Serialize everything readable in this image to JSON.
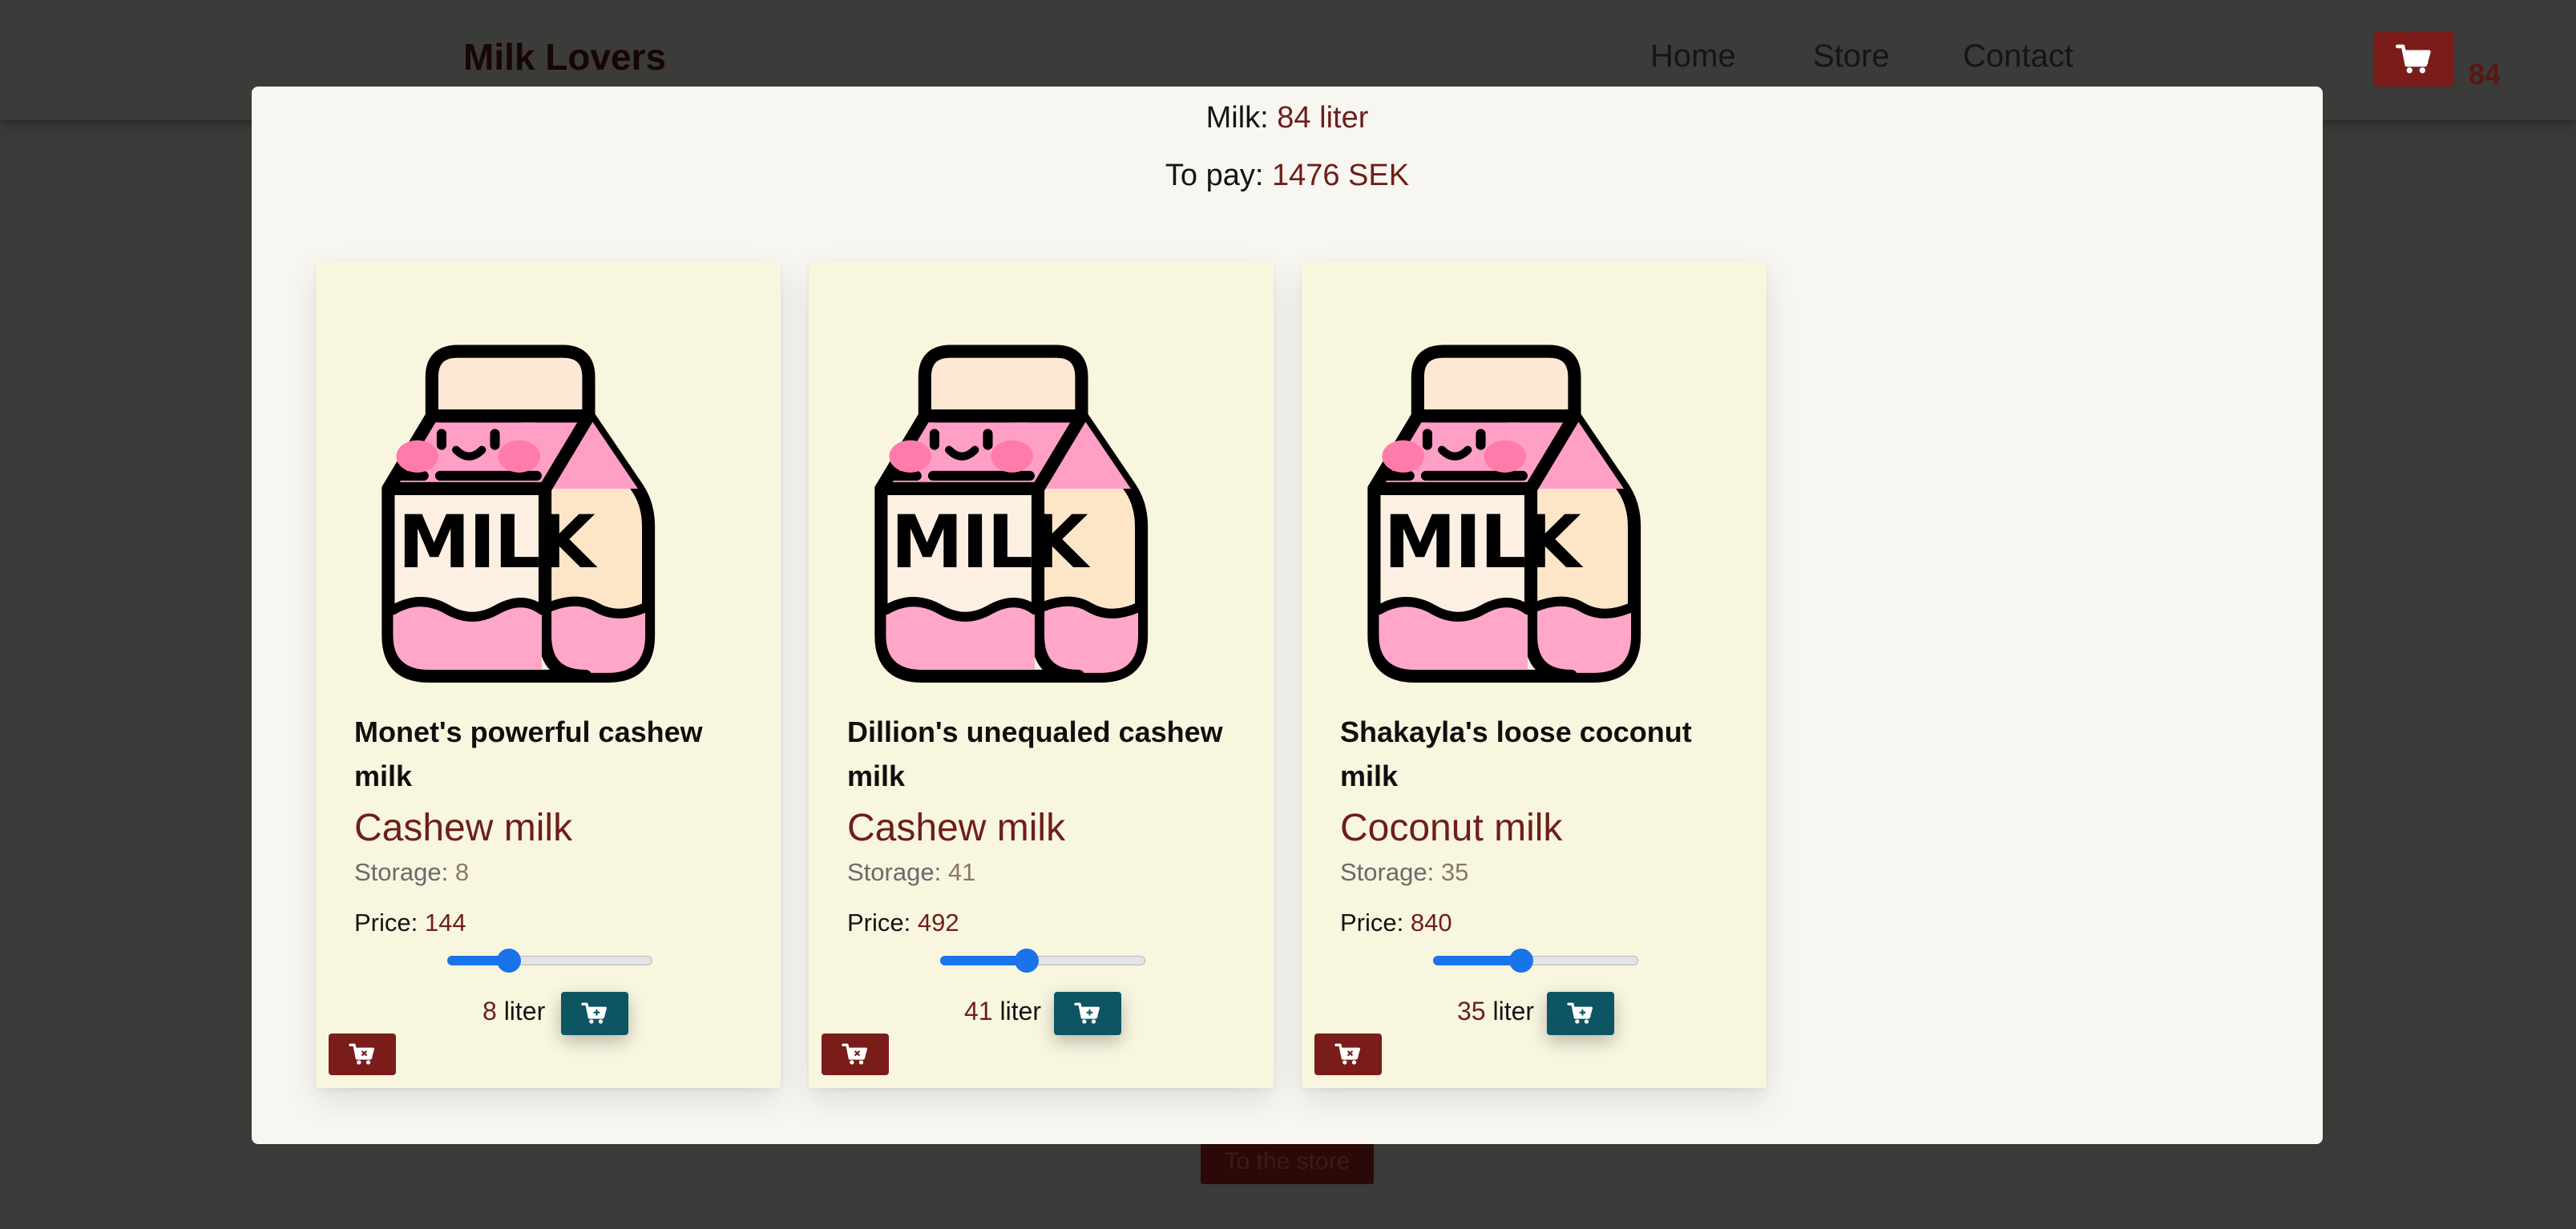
{
  "navbar": {
    "brand": "Milk Lovers",
    "links": [
      "Home",
      "Store",
      "Contact"
    ],
    "cart_count": "84"
  },
  "page": {
    "store_button": "To the store"
  },
  "modal": {
    "milk_label": "Milk:",
    "milk_value": "84 liter",
    "pay_label": "To pay:",
    "pay_value": "1476 SEK",
    "carton_text": "MILK",
    "cards": [
      {
        "name": "Monet's powerful cashew milk",
        "type": "Cashew milk",
        "storage_label": "Storage:",
        "storage": "8",
        "price_label": "Price:",
        "price": "144",
        "quantity": "8",
        "unit": "liter",
        "slider_fraction": 0.3
      },
      {
        "name": "Dillion's unequaled cashew milk",
        "type": "Cashew milk",
        "storage_label": "Storage:",
        "storage": "41",
        "price_label": "Price:",
        "price": "492",
        "quantity": "41",
        "unit": "liter",
        "slider_fraction": 0.42
      },
      {
        "name": "Shakayla's loose coconut milk",
        "type": "Coconut milk",
        "storage_label": "Storage:",
        "storage": "35",
        "price_label": "Price:",
        "price": "840",
        "quantity": "35",
        "unit": "liter",
        "slider_fraction": 0.43
      }
    ]
  },
  "colors": {
    "accent_red": "#7a1d1a",
    "accent_teal": "#0d5563",
    "slider_blue": "#1a73e8",
    "card_bg": "#f8f6df",
    "carton_pink": "#ffa6c9",
    "carton_cream": "#fde6c8"
  },
  "icons": [
    "cart-icon",
    "cart-add-icon",
    "cart-remove-icon",
    "milk-carton-icon"
  ]
}
